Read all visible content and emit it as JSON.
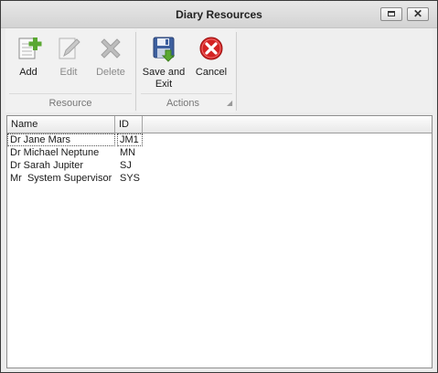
{
  "window": {
    "title": "Diary Resources"
  },
  "titlebar_buttons": {
    "maximize_icon": "maximize-icon",
    "close_icon": "close-x-icon",
    "close_glyph": "✕"
  },
  "ribbon": {
    "groups": [
      {
        "label": "Resource"
      },
      {
        "label": "Actions"
      }
    ],
    "buttons": {
      "add": {
        "label": "Add",
        "icon": "add-document-icon",
        "enabled": true
      },
      "edit": {
        "label": "Edit",
        "icon": "edit-pencil-icon",
        "enabled": false
      },
      "delete": {
        "label": "Delete",
        "icon": "delete-x-icon",
        "enabled": false
      },
      "save_exit": {
        "label_line1": "Save and",
        "label_line2": "Exit",
        "icon": "save-disk-icon",
        "enabled": true
      },
      "cancel": {
        "label": "Cancel",
        "icon": "cancel-icon",
        "enabled": true
      }
    }
  },
  "grid": {
    "columns": [
      {
        "label": "Name"
      },
      {
        "label": "ID"
      }
    ],
    "rows": [
      {
        "name": "Dr Jane Mars",
        "id": "JM1"
      },
      {
        "name": "Dr Michael Neptune",
        "id": "MN"
      },
      {
        "name": "Dr Sarah Jupiter",
        "id": "SJ"
      },
      {
        "name": "Mr  System Supervisor",
        "id": "SYS"
      }
    ],
    "selected_row": 0
  },
  "colors": {
    "accent_green": "#5aa832",
    "cancel_red": "#d42424",
    "disk_blue": "#3d5f9e"
  }
}
